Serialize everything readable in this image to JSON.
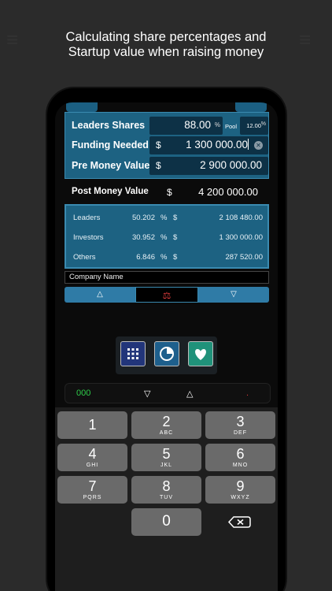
{
  "headline": {
    "line1": "Calculating share percentages and",
    "line2": "Startup value when raising money"
  },
  "inputs": {
    "leaders_label": "Leaders Shares",
    "leaders_value": "88.00",
    "leaders_unit": "%",
    "pool_label": "Pool",
    "pool_value": "12.00",
    "pool_unit": "%",
    "funding_label": "Funding Needed",
    "funding_currency": "$",
    "funding_value": "1 300 000.00",
    "premoney_label": "Pre Money Value",
    "premoney_currency": "$",
    "premoney_value": "2 900 000.00"
  },
  "postmoney": {
    "label": "Post Money Value",
    "currency": "$",
    "value": "4 200 000.00"
  },
  "results": [
    {
      "name": "Leaders",
      "pct": "50.202",
      "pct_unit": "%",
      "currency": "$",
      "amount": "2 108 480.00"
    },
    {
      "name": "Investors",
      "pct": "30.952",
      "pct_unit": "%",
      "currency": "$",
      "amount": "1 300 000.00"
    },
    {
      "name": "Others",
      "pct": "6.846",
      "pct_unit": "%",
      "currency": "$",
      "amount": "287 520.00"
    }
  ],
  "company": {
    "placeholder": "Company Name"
  },
  "segment": {
    "up": "△",
    "scale": "⚖",
    "down": "▽"
  },
  "toolbar": {
    "calculator_icon": "calculator-grid-icon",
    "chart_icon": "pie-chart-icon",
    "heart_icon": "heart-icon"
  },
  "keybar": {
    "code": "000",
    "down": "▽",
    "up": "△",
    "dot": "."
  },
  "keypad": {
    "keys": [
      {
        "n": "1",
        "l": ""
      },
      {
        "n": "2",
        "l": "ABC"
      },
      {
        "n": "3",
        "l": "DEF"
      },
      {
        "n": "4",
        "l": "GHI"
      },
      {
        "n": "5",
        "l": "JKL"
      },
      {
        "n": "6",
        "l": "MNO"
      },
      {
        "n": "7",
        "l": "PQRS"
      },
      {
        "n": "8",
        "l": "TUV"
      },
      {
        "n": "9",
        "l": "WXYZ"
      },
      {
        "n": "0",
        "l": ""
      }
    ]
  },
  "colors": {
    "accent": "#1d6282",
    "field": "#0d3146",
    "green": "#2ecc4a",
    "red": "#d63a3a"
  }
}
